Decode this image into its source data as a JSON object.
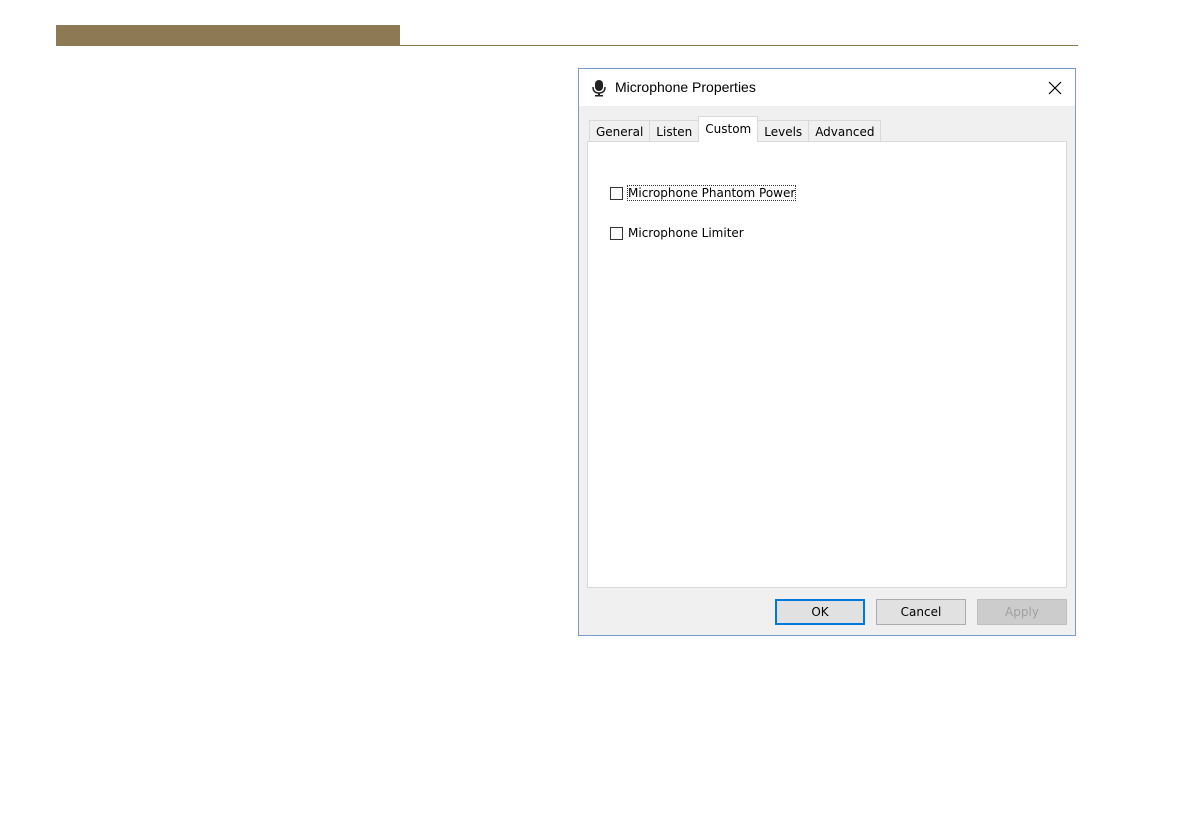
{
  "window": {
    "title": "Microphone Properties",
    "icon": "microphone-icon",
    "close_glyph": "✕"
  },
  "tabs": [
    {
      "label": "General",
      "active": false
    },
    {
      "label": "Listen",
      "active": false
    },
    {
      "label": "Custom",
      "active": true
    },
    {
      "label": "Levels",
      "active": false
    },
    {
      "label": "Advanced",
      "active": false
    }
  ],
  "options": {
    "phantom_power": {
      "label": "Microphone Phantom Power",
      "checked": false
    },
    "limiter": {
      "label": "Microphone Limiter",
      "checked": false
    }
  },
  "buttons": {
    "ok": "OK",
    "cancel": "Cancel",
    "apply": "Apply"
  },
  "colors": {
    "document_accent": "#8d7a55",
    "focus_border": "#0078d7",
    "dialog_border": "#7a9cc8"
  }
}
